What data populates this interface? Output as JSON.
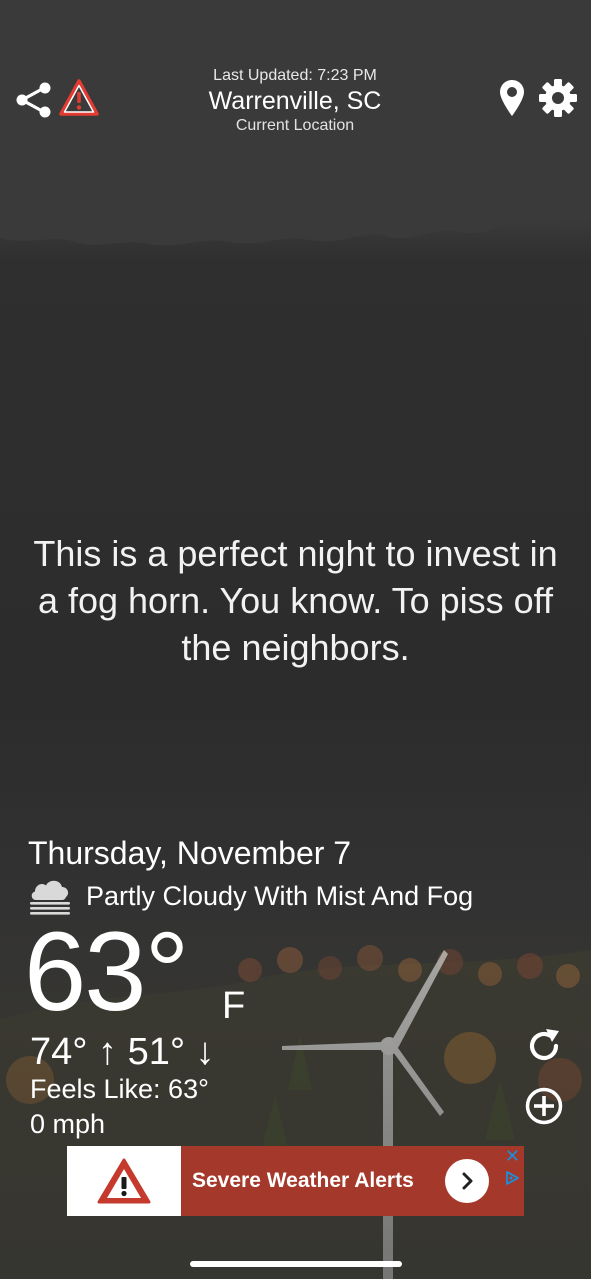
{
  "header": {
    "last_updated": "Last Updated: 7:23 PM",
    "city": "Warrenville, SC",
    "location_label": "Current Location"
  },
  "icons": {
    "share": "share-icon",
    "alert": "warning-triangle-icon",
    "location": "location-pin-icon",
    "settings": "gear-icon",
    "condition": "cloud-fog-icon",
    "refresh": "refresh-icon",
    "add": "plus-circle-icon"
  },
  "quote": "This is a perfect night to invest in a fog horn. You know. To piss off the neighbors.",
  "weather": {
    "date": "Thursday, November 7",
    "condition": "Partly Cloudy With Mist And Fog",
    "temperature": "63°",
    "unit": "F",
    "high_low": "74° ↑  51° ↓",
    "feels_like": "Feels Like: 63°",
    "wind": "0 mph"
  },
  "ad": {
    "text": "Severe Weather Alerts",
    "close": "✕",
    "brand_color": "#a4392b"
  },
  "colors": {
    "alert_red": "#e23b32",
    "ad_banner": "#a4392b",
    "ad_icon_red": "#c53a2c"
  }
}
